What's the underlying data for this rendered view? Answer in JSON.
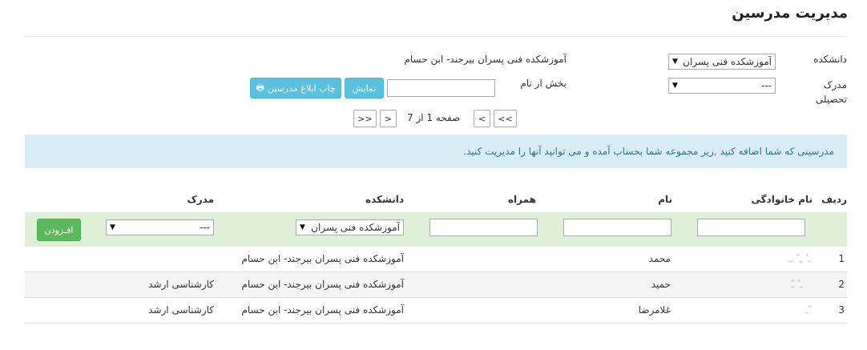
{
  "page": {
    "title": "مدیریت مدرسین"
  },
  "form": {
    "faculty_label": "دانشکده",
    "faculty_select_value": "آموزشکده فنی پسران بیرجند- ابن حسام",
    "faculty_select_visible": "آموزشکده فنی پسران بـ",
    "faculty_name_text": "آموزشکده فنی پسران بیرجند- ابن حسام",
    "degree_label": "مدرک تحصیلی",
    "degree_select_value": "---",
    "name_part_label": "بخش از نام",
    "name_part_value": "",
    "show_button": "نمایش",
    "print_button": "چاپ ابلاغ مدرسین"
  },
  "pagination": {
    "first": "<<",
    "prev": "<",
    "page_text": "صفحه 1 از 7",
    "next": ">",
    "last": ">>"
  },
  "info_message": "مدرسینی که شما اضافه کنید ,زیر مجموعه شما بحساب آمده و می توانید آنها را مدیریت کنید.",
  "table": {
    "headers": {
      "row": "ردیف",
      "family": "نام خانوادگی",
      "name": "نام",
      "companion": "همراه",
      "faculty": "دانشکده",
      "degree": "مدرک"
    },
    "filter": {
      "faculty_value": "آموزشکده فنی پسران بـ",
      "degree_value": "---",
      "add_button": "افـزودن"
    },
    "rows": [
      {
        "index": "1",
        "family": "ـ ُ ـِ ّ ــ",
        "name": "محمد",
        "faculty": "آموزشکده فنی پسران بیرجند- ابن حسام",
        "degree": ""
      },
      {
        "index": "2",
        "family": "ـ ُ ـّ",
        "name": "حمید",
        "faculty": "آموزشکده فنی پسران بیرجند- ابن حسام",
        "degree": "کارشناسی ارشد"
      },
      {
        "index": "3",
        "family": "ـ ّ",
        "name": "غلامرضا",
        "faculty": "آموزشکده فنی پسران بیرجند- ابن حسام",
        "degree": "کارشناسی ارشد"
      }
    ]
  }
}
